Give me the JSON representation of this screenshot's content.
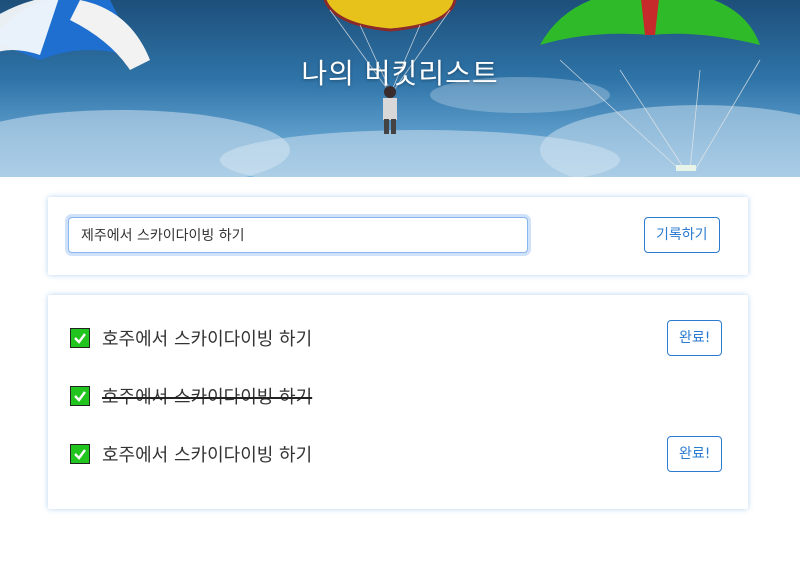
{
  "header": {
    "title": "나의 버킷리스트"
  },
  "form": {
    "input_value": "제주에서 스카이다이빙 하기",
    "submit_label": "기록하기"
  },
  "items": [
    {
      "text": "호주에서 스카이다이빙 하기",
      "done": false,
      "button_label": "완료!"
    },
    {
      "text": "호주에서 스카이다이빙 하기",
      "done": true
    },
    {
      "text": "호주에서 스카이다이빙 하기",
      "done": false,
      "button_label": "완료!"
    }
  ],
  "colors": {
    "accent": "#2b7bd1",
    "check_green": "#22c41e",
    "sky": "#2f74a8"
  },
  "icons": {
    "item_check": "check-box-icon"
  }
}
